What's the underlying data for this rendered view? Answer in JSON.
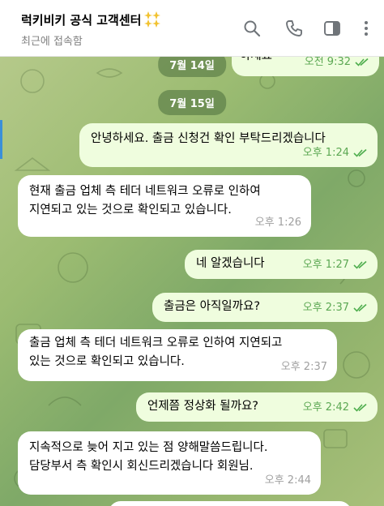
{
  "header": {
    "title": "럭키비키 공식 고객센터",
    "status": "최근에 접속함",
    "icons": [
      "search-icon",
      "phone-icon",
      "sidebar-toggle-icon",
      "more-icon"
    ]
  },
  "colors": {
    "outgoing_bubble": "#effdde",
    "incoming_bubble": "#ffffff",
    "read_check": "#4fae4e",
    "date_pill": "#4a6e3c"
  },
  "chat": {
    "partial": {
      "date_label": "7월 14일",
      "text_fragment": "하세요",
      "time": "오전 9:32"
    },
    "date_label": "7월 15일",
    "messages": [
      {
        "dir": "out",
        "text": "안녕하세요. 출금 신청건 확인 부탁드리겠습니다",
        "time": "오후 1:24",
        "read": true
      },
      {
        "dir": "in",
        "text": "현재 출금 업체 측 테더 네트워크 오류로 인하여\n지연되고 있는 것으로 확인되고 있습니다.",
        "time": "오후 1:26"
      },
      {
        "dir": "out",
        "text": "네 알겠습니다",
        "time": "오후 1:27",
        "read": true
      },
      {
        "dir": "out",
        "text": "출금은 아직일까요?",
        "time": "오후 2:37",
        "read": true
      },
      {
        "dir": "in",
        "text": "출금 업체 측 테더 네트워크 오류로 인하여 지연되고\n있는 것으로 확인되고 있습니다.",
        "time": "오후 2:37"
      },
      {
        "dir": "out",
        "text": "언제쯤 정상화 될까요?",
        "time": "오후 2:42",
        "read": true
      },
      {
        "dir": "in",
        "text": "지속적으로 늦어 지고 있는 점 양해말씀드립니다.\n담당부서 측 확인시 회신드리겠습니다 회원님.",
        "time": "오후 2:44"
      }
    ]
  }
}
